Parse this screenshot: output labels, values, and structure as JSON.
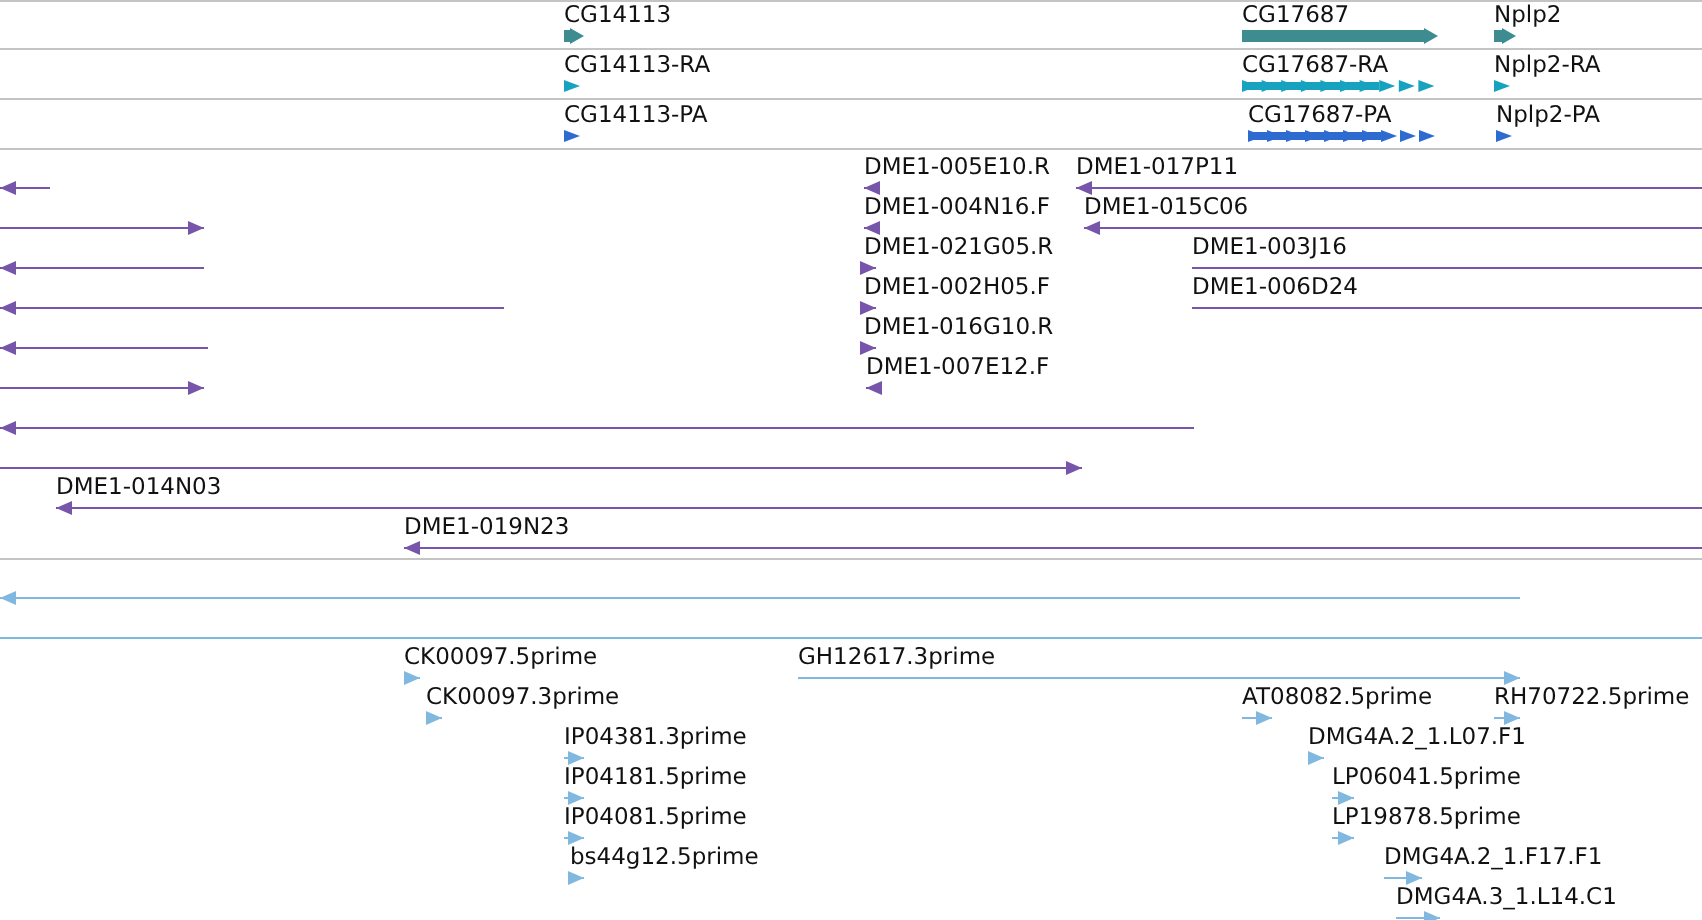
{
  "tracks": [
    {
      "kind": "gene",
      "color": "#3d8c90",
      "features": [
        {
          "label": "CG14113",
          "reverse": false
        },
        {
          "label": "CG17687",
          "reverse": false
        },
        {
          "label": "Nplp2",
          "reverse": false
        }
      ]
    },
    {
      "kind": "transcript",
      "color": "#17a2bf",
      "features": [
        {
          "label": "CG14113-RA",
          "reverse": false
        },
        {
          "label": "CG17687-RA",
          "reverse": false
        },
        {
          "label": "Nplp2-RA",
          "reverse": false
        }
      ]
    },
    {
      "kind": "protein",
      "color": "#2e6bd0",
      "features": [
        {
          "label": "CG14113-PA",
          "reverse": false
        },
        {
          "label": "CG17687-PA",
          "reverse": false
        },
        {
          "label": "Nplp2-PA",
          "reverse": false
        }
      ]
    },
    {
      "kind": "clone",
      "color": "#7755aa",
      "features": [
        {
          "reverse": true
        },
        {
          "label": "DME1-005E10.R",
          "reverse": true
        },
        {
          "label": "DME1-017P11",
          "reverse": true
        },
        {
          "reverse": false
        },
        {
          "label": "DME1-004N16.F",
          "reverse": true
        },
        {
          "label": "DME1-015C06",
          "reverse": true
        },
        {
          "reverse": true
        },
        {
          "label": "DME1-021G05.R",
          "reverse": false
        },
        {
          "label": "DME1-003J16",
          "reverse": false
        },
        {
          "reverse": true
        },
        {
          "label": "DME1-002H05.F",
          "reverse": false
        },
        {
          "label": "DME1-006D24",
          "reverse": false
        },
        {
          "reverse": true
        },
        {
          "label": "DME1-016G10.R",
          "reverse": false
        },
        {
          "reverse": false
        },
        {
          "label": "DME1-007E12.F",
          "reverse": true
        },
        {
          "reverse": true
        },
        {
          "reverse": false
        },
        {
          "label": "DME1-014N03",
          "reverse": true
        },
        {
          "label": "DME1-019N23",
          "reverse": true
        }
      ]
    },
    {
      "kind": "est",
      "color": "#80b8e0",
      "features": [
        {
          "reverse": true
        },
        {
          "reverse": false
        },
        {
          "label": "CK00097.5prime",
          "reverse": false
        },
        {
          "label": "GH12617.3prime",
          "reverse": false
        },
        {
          "label": "CK00097.3prime",
          "reverse": false
        },
        {
          "label": "AT08082.5prime",
          "reverse": false
        },
        {
          "label": "RH70722.5prime",
          "reverse": false
        },
        {
          "label": "IP04381.3prime",
          "reverse": false
        },
        {
          "label": "DMG4A.2_1.L07.F1",
          "reverse": false
        },
        {
          "label": "IP04181.5prime",
          "reverse": false
        },
        {
          "label": "LP06041.5prime",
          "reverse": false
        },
        {
          "label": "IP04081.5prime",
          "reverse": false
        },
        {
          "label": "LP19878.5prime",
          "reverse": false
        },
        {
          "label": "bs44g12.5prime",
          "reverse": false
        },
        {
          "label": "DMG4A.2_1.F17.F1",
          "reverse": false
        },
        {
          "label": "DMG4A.3_1.L14.C1",
          "reverse": false
        }
      ]
    }
  ]
}
